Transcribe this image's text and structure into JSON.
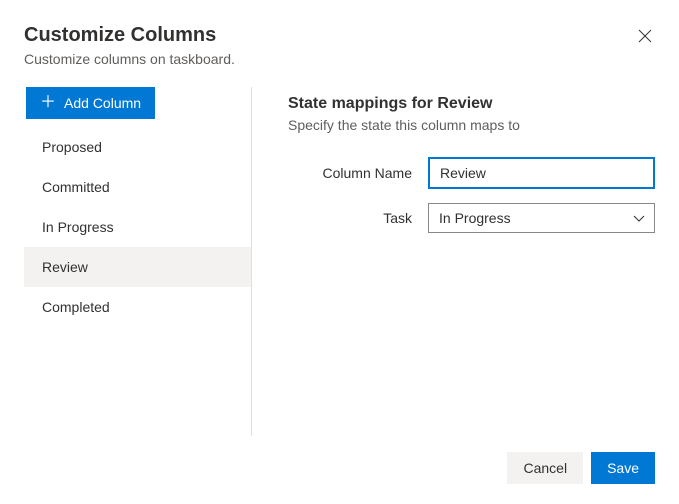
{
  "header": {
    "title": "Customize Columns",
    "subtitle": "Customize columns on taskboard."
  },
  "sidebar": {
    "add_label": "Add Column",
    "columns": [
      {
        "label": "Proposed",
        "selected": false
      },
      {
        "label": "Committed",
        "selected": false
      },
      {
        "label": "In Progress",
        "selected": false
      },
      {
        "label": "Review",
        "selected": true
      },
      {
        "label": "Completed",
        "selected": false
      }
    ]
  },
  "main": {
    "section_title": "State mappings for Review",
    "section_desc": "Specify the state this column maps to",
    "column_name_label": "Column Name",
    "column_name_value": "Review",
    "task_label": "Task",
    "task_value": "In Progress"
  },
  "footer": {
    "cancel": "Cancel",
    "save": "Save"
  }
}
